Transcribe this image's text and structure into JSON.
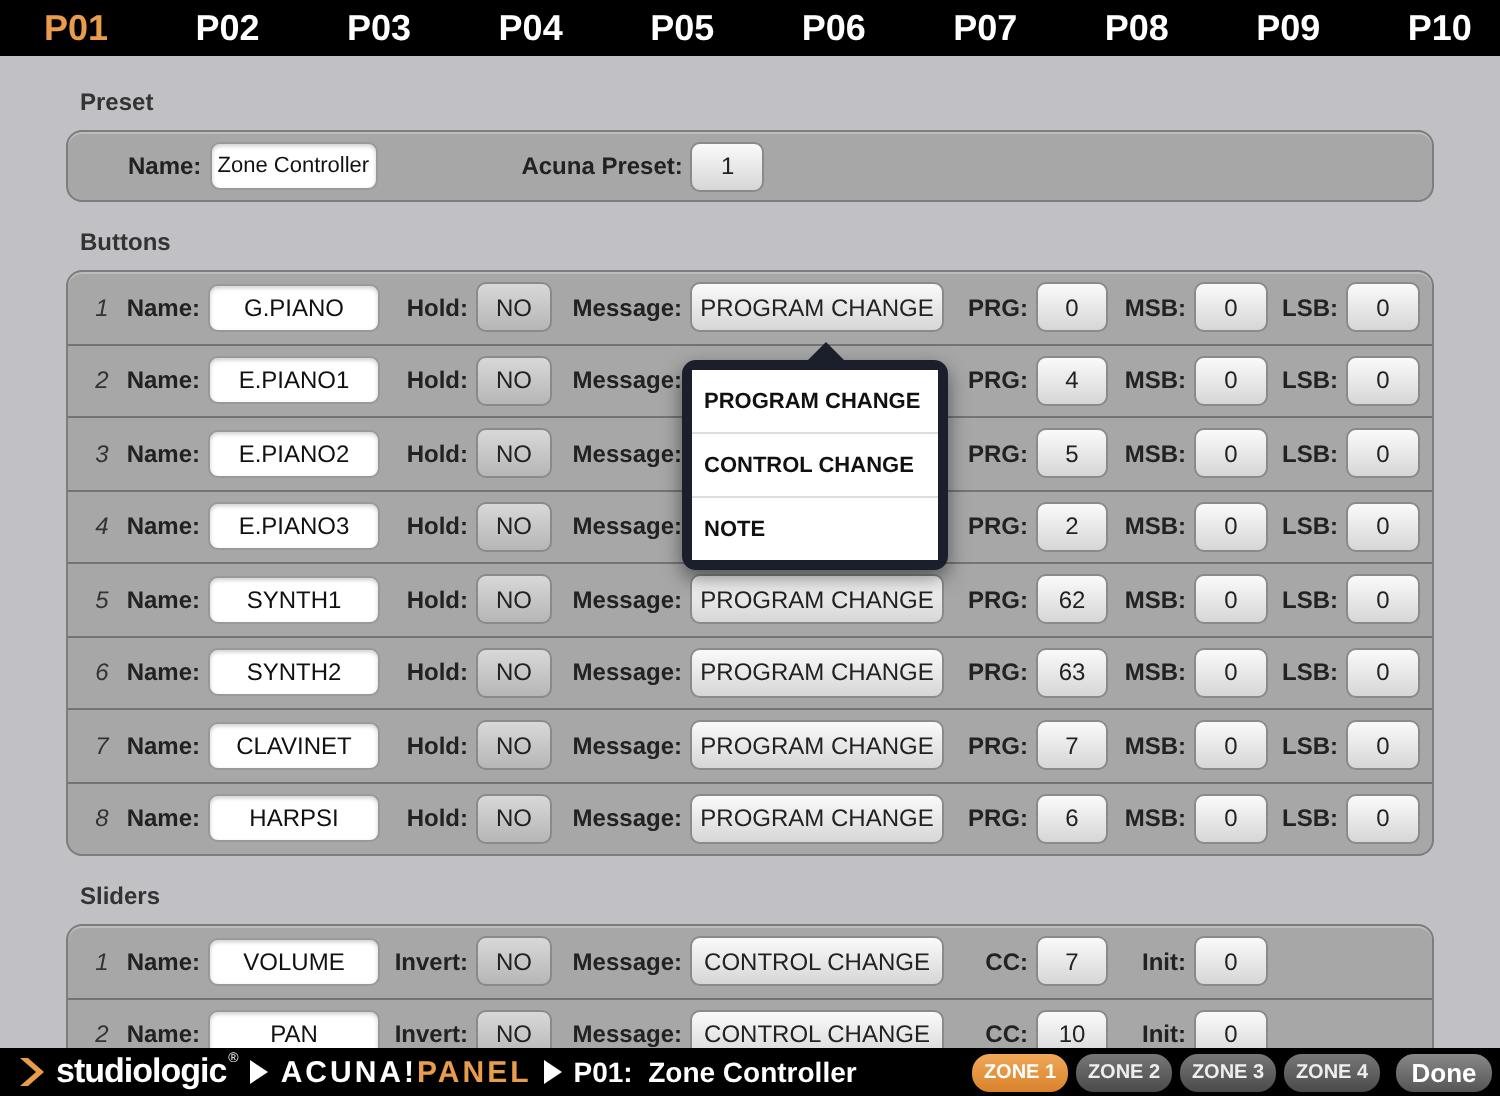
{
  "pages": [
    {
      "label": "P01",
      "selected": true
    },
    {
      "label": "P02",
      "selected": false
    },
    {
      "label": "P03",
      "selected": false
    },
    {
      "label": "P04",
      "selected": false
    },
    {
      "label": "P05",
      "selected": false
    },
    {
      "label": "P06",
      "selected": false
    },
    {
      "label": "P07",
      "selected": false
    },
    {
      "label": "P08",
      "selected": false
    },
    {
      "label": "P09",
      "selected": false
    },
    {
      "label": "P10",
      "selected": false
    }
  ],
  "preset": {
    "title": "Preset",
    "name_label": "Name:",
    "name": "Zone Controller",
    "acuna_label": "Acuna Preset:",
    "acuna_value": "1"
  },
  "buttons": {
    "title": "Buttons",
    "rows": [
      {
        "number": "1",
        "name_label": "Name:",
        "name": "G.PIANO",
        "hold_label": "Hold:",
        "hold": "NO",
        "message_label": "Message:",
        "message": "PROGRAM CHANGE",
        "prg_label": "PRG:",
        "prg": "0",
        "msb_label": "MSB:",
        "msb": "0",
        "lsb_label": "LSB:",
        "lsb": "0"
      },
      {
        "number": "2",
        "name_label": "Name:",
        "name": "E.PIANO1",
        "hold_label": "Hold:",
        "hold": "NO",
        "message_label": "Message:",
        "prg_label": "PRG:",
        "prg": "4",
        "msb_label": "MSB:",
        "msb": "0",
        "lsb_label": "LSB:",
        "lsb": "0"
      },
      {
        "number": "3",
        "name_label": "Name:",
        "name": "E.PIANO2",
        "hold_label": "Hold:",
        "hold": "NO",
        "message_label": "Message:",
        "prg_label": "PRG:",
        "prg": "5",
        "msb_label": "MSB:",
        "msb": "0",
        "lsb_label": "LSB:",
        "lsb": "0"
      },
      {
        "number": "4",
        "name_label": "Name:",
        "name": "E.PIANO3",
        "hold_label": "Hold:",
        "hold": "NO",
        "message_label": "Message:",
        "prg_label": "PRG:",
        "prg": "2",
        "msb_label": "MSB:",
        "msb": "0",
        "lsb_label": "LSB:",
        "lsb": "0"
      },
      {
        "number": "5",
        "name_label": "Name:",
        "name": "SYNTH1",
        "hold_label": "Hold:",
        "hold": "NO",
        "message_label": "Message:",
        "message": "PROGRAM CHANGE",
        "prg_label": "PRG:",
        "prg": "62",
        "msb_label": "MSB:",
        "msb": "0",
        "lsb_label": "LSB:",
        "lsb": "0"
      },
      {
        "number": "6",
        "name_label": "Name:",
        "name": "SYNTH2",
        "hold_label": "Hold:",
        "hold": "NO",
        "message_label": "Message:",
        "message": "PROGRAM CHANGE",
        "prg_label": "PRG:",
        "prg": "63",
        "msb_label": "MSB:",
        "msb": "0",
        "lsb_label": "LSB:",
        "lsb": "0"
      },
      {
        "number": "7",
        "name_label": "Name:",
        "name": "CLAVINET",
        "hold_label": "Hold:",
        "hold": "NO",
        "message_label": "Message:",
        "message": "PROGRAM CHANGE",
        "prg_label": "PRG:",
        "prg": "7",
        "msb_label": "MSB:",
        "msb": "0",
        "lsb_label": "LSB:",
        "lsb": "0"
      },
      {
        "number": "8",
        "name_label": "Name:",
        "name": "HARPSI",
        "hold_label": "Hold:",
        "hold": "NO",
        "message_label": "Message:",
        "message": "PROGRAM CHANGE",
        "prg_label": "PRG:",
        "prg": "6",
        "msb_label": "MSB:",
        "msb": "0",
        "lsb_label": "LSB:",
        "lsb": "0"
      }
    ],
    "menu": {
      "items": [
        {
          "label": "PROGRAM CHANGE"
        },
        {
          "label": "CONTROL CHANGE"
        },
        {
          "label": "NOTE"
        }
      ]
    }
  },
  "sliders": {
    "title": "Sliders",
    "rows": [
      {
        "number": "1",
        "name_label": "Name:",
        "name": "VOLUME",
        "invert_label": "Invert:",
        "invert": "NO",
        "message_label": "Message:",
        "message": "CONTROL CHANGE",
        "cc_label": "CC:",
        "cc": "7",
        "init_label": "Init:",
        "init": "0"
      },
      {
        "number": "2",
        "name_label": "Name:",
        "name": "PAN",
        "invert_label": "Invert:",
        "invert": "NO",
        "message_label": "Message:",
        "message": "CONTROL CHANGE",
        "cc_label": "CC:",
        "cc": "10",
        "init_label": "Init:",
        "init": "0"
      }
    ]
  },
  "footer": {
    "brand": "studiologic",
    "brand_mark": "®",
    "product_first": "ACUNA!",
    "product_second": "PANEL",
    "title": "P01:  Zone Controller",
    "zones": [
      {
        "label": "ZONE 1",
        "selected": true
      },
      {
        "label": "ZONE 2",
        "selected": false
      },
      {
        "label": "ZONE 3",
        "selected": false
      },
      {
        "label": "ZONE 4",
        "selected": false
      }
    ],
    "done": "Done"
  }
}
